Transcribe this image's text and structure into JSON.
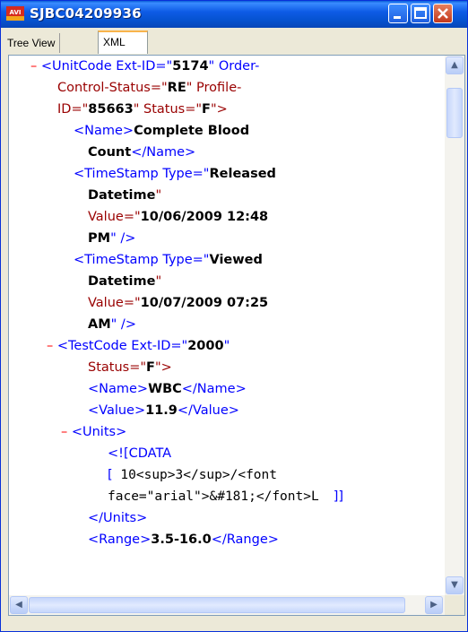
{
  "window": {
    "title": "SJBC04209936",
    "logo_text": "AVI",
    "colors": {
      "titlebar": "#0A5FD8",
      "tag": "#990000",
      "attr": "#0000FF",
      "minus": "#FF0000"
    }
  },
  "tabs": [
    {
      "label": "Tree View",
      "active": false
    },
    {
      "label": "XML",
      "active": true
    }
  ],
  "xml": {
    "l1_minus": "–",
    "l1_open": "<UnitCode Ext-ID=\"",
    "l1_val": "5174",
    "l1_rest": "\" Order-",
    "l2_a": "Control-Status=\"",
    "l2_val": "RE",
    "l2_b": "\" Profile-",
    "l3_a": "ID=\"",
    "l3_val": "85663",
    "l3_b": "\" Status=\"",
    "l3_val2": "F",
    "l3_c": "\">",
    "l4_open": "<Name>",
    "l4_text": "Complete Blood",
    "l5_text": "Count",
    "l5_close": "</Name>",
    "l6_open": "<TimeStamp Type=\"",
    "l6_val": "Released",
    "l7_val": "Datetime",
    "l7_q": "\"",
    "l8_a": "Value=\"",
    "l8_val": "10/06/2009 12:48",
    "l9_val": "PM",
    "l9_b": "\" />",
    "l10_open": "<TimeStamp Type=\"",
    "l10_val": "Viewed",
    "l11_val": "Datetime",
    "l11_q": "\"",
    "l12_a": "Value=\"",
    "l12_val": "10/07/2009 07:25",
    "l13_val": "AM",
    "l13_b": "\" />",
    "l14_minus": "–",
    "l14_open": "<TestCode Ext-ID=\"",
    "l14_val": "2000",
    "l14_q": "\"",
    "l15_a": "Status=\"",
    "l15_val": "F",
    "l15_b": "\">",
    "l16_open": "<Name>",
    "l16_text": "WBC",
    "l16_close": "</Name>",
    "l17_open": "<Value>",
    "l17_text": "11.9",
    "l17_close": "</Value>",
    "l18_minus": "–",
    "l18_open": "<Units>",
    "l19_text": "<![CDATA",
    "l20_a": "[",
    "l20_b": " 10<sup>3</sup>/<font",
    "l21_a": "face=\"arial\">&#181;</font>L",
    "l21_b": "]]",
    "l22_close": "</Units>",
    "l23_open": "<Range>",
    "l23_text": "3.5-16.0",
    "l23_close": "</Range>"
  }
}
